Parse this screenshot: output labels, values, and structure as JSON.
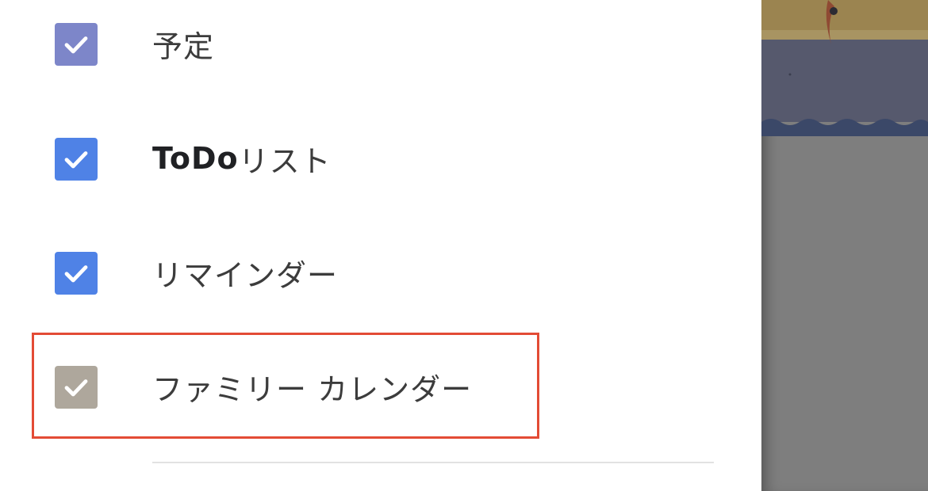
{
  "calendars": [
    {
      "label": "予定",
      "checked": true,
      "color": "#7d86c9"
    },
    {
      "label_bold": "ToDo",
      "label_rest": "リスト",
      "checked": true,
      "color": "#4f82e6"
    },
    {
      "label": "リマインダー",
      "checked": true,
      "color": "#4f82e6"
    },
    {
      "label": "ファミリー カレンダー",
      "checked": true,
      "color": "#aea79c",
      "highlighted": true
    }
  ],
  "highlight_color": "#e34b35",
  "icons": {
    "check": "checkmark-icon"
  }
}
